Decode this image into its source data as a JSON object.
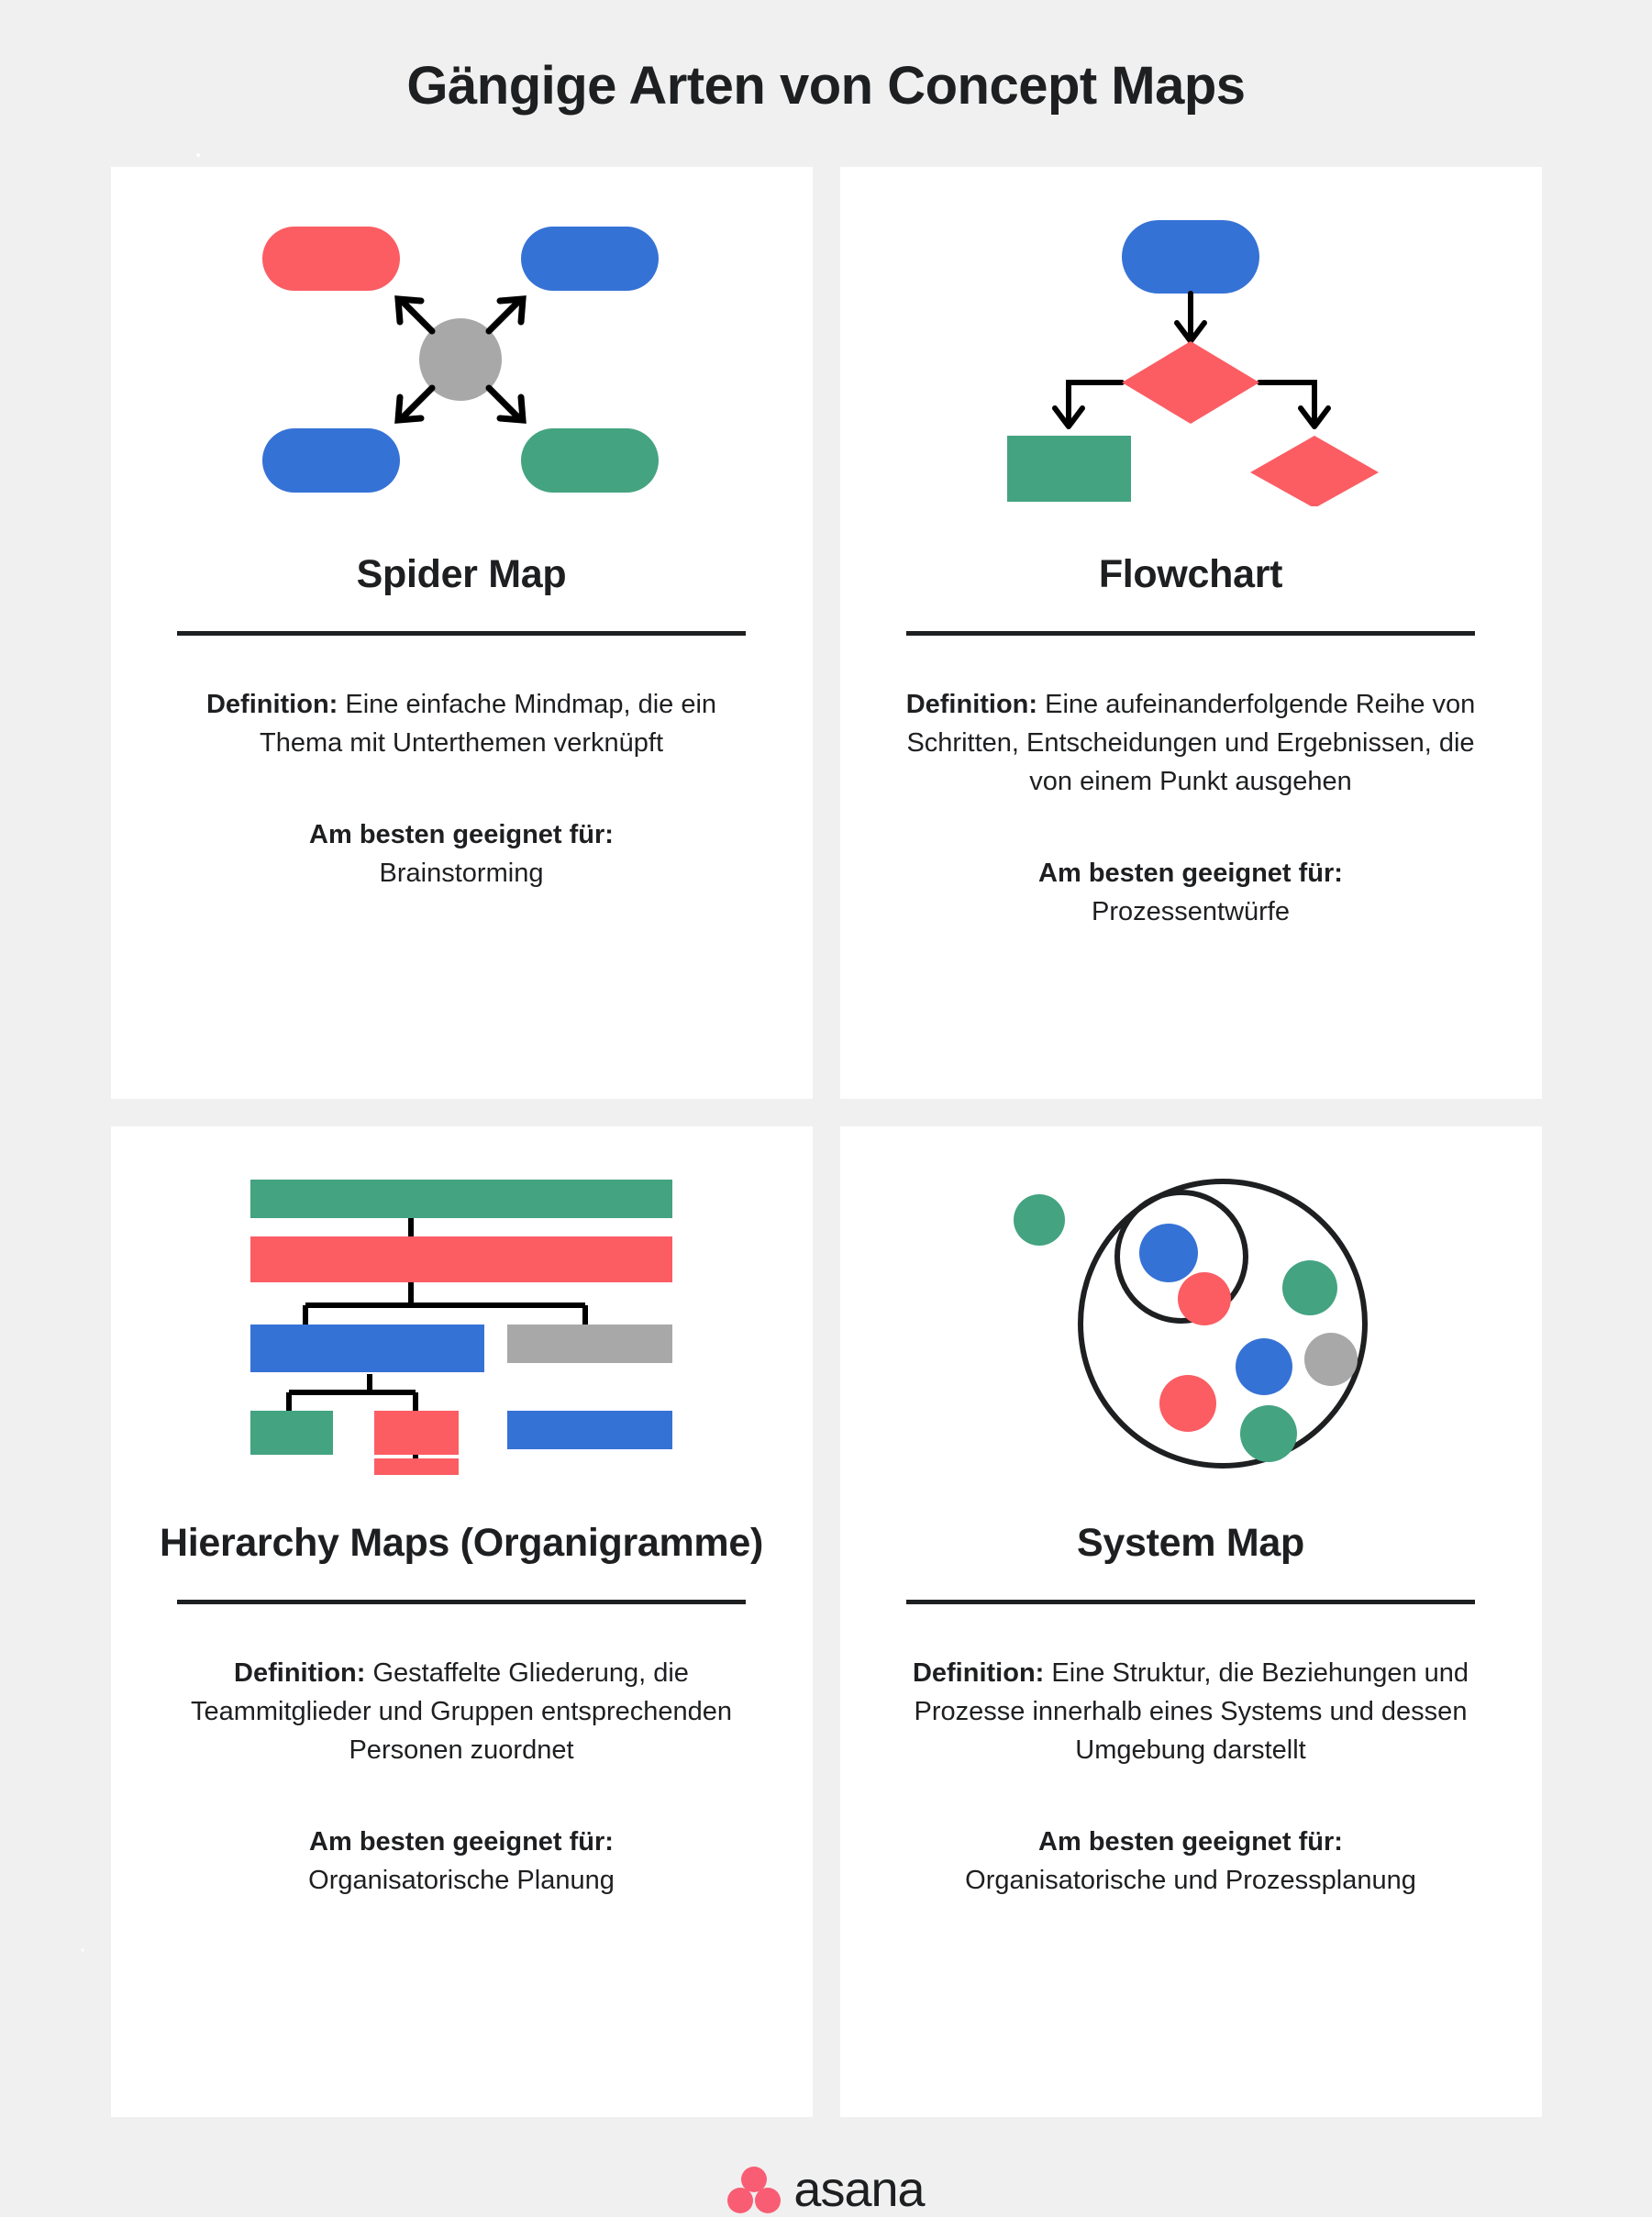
{
  "page": {
    "title": "Gängige Arten von Concept Maps",
    "background_color": "#F0F0F0",
    "card_background": "#FFFFFF",
    "text_color": "#1E1F21"
  },
  "palette": {
    "red": "#FB5D63",
    "blue": "#3572D6",
    "green": "#44A381",
    "gray": "#A8A8A8",
    "black": "#1E1F21",
    "asana_coral": "#F95D74"
  },
  "labels": {
    "definition_label": "Definition:",
    "best_for_label": "Am besten geeignet für:"
  },
  "cards": [
    {
      "id": "spider-map",
      "title": "Spider Map",
      "definition_label": "Definition:",
      "definition_text": "Eine einfache Mindmap, die ein Thema mit Unterthemen verknüpft",
      "best_for_label": "Am besten geeignet für:",
      "best_for_value": "Brainstorming",
      "diagram": {
        "type": "spider",
        "center_node": {
          "shape": "circle",
          "color": "#A8A8A8"
        },
        "nodes": [
          {
            "position": "top-left",
            "shape": "pill",
            "color": "#FB5D63"
          },
          {
            "position": "top-right",
            "shape": "pill",
            "color": "#3572D6"
          },
          {
            "position": "bottom-left",
            "shape": "pill",
            "color": "#3572D6"
          },
          {
            "position": "bottom-right",
            "shape": "pill",
            "color": "#44A381"
          }
        ],
        "connector_count": 4,
        "connector_style": "diagonal-arrow"
      }
    },
    {
      "id": "flowchart",
      "title": "Flowchart",
      "definition_label": "Definition:",
      "definition_text": "Eine aufeinanderfolgende Reihe von Schritten, Entscheidungen und Ergebnissen, die von einem Punkt ausgehen",
      "best_for_label": "Am besten geeignet für:",
      "best_for_value": "Prozessentwürfe",
      "diagram": {
        "type": "flowchart",
        "nodes": [
          {
            "id": "start",
            "shape": "pill",
            "color": "#3572D6"
          },
          {
            "id": "decision-1",
            "shape": "diamond",
            "color": "#FB5D63"
          },
          {
            "id": "result",
            "shape": "rect",
            "color": "#44A381"
          },
          {
            "id": "decision-2",
            "shape": "diamond",
            "color": "#FB5D63"
          }
        ],
        "connector_count": 3,
        "connector_style": "orthogonal-arrow"
      }
    },
    {
      "id": "hierarchy-map",
      "title": "Hierarchy Maps (Organigramme)",
      "title_lines": [
        "Hierarchy Maps",
        "(Organigramme)"
      ],
      "definition_label": "Definition:",
      "definition_text": "Gestaffelte Gliederung, die Teammitglieder und Gruppen entsprechenden Personen zuordnet",
      "best_for_label": "Am besten geeignet für:",
      "best_for_value": "Organisatorische Planung",
      "diagram": {
        "type": "hierarchy",
        "levels": [
          [
            {
              "color": "#44A381",
              "width": "full"
            }
          ],
          [
            {
              "color": "#FB5D63",
              "width": "full"
            }
          ],
          [
            {
              "color": "#3572D6",
              "width": "half"
            },
            {
              "color": "#A8A8A8",
              "width": "half"
            }
          ],
          [
            {
              "color": "#44A381",
              "width": "quarter"
            },
            {
              "color": "#FB5D63",
              "width": "quarter"
            },
            {
              "color": "#3572D6",
              "width": "half"
            }
          ],
          [
            {
              "color": "#FB5D63",
              "width": "quarter"
            }
          ]
        ],
        "connector_style": "orthogonal-line"
      }
    },
    {
      "id": "system-map",
      "title": "System Map",
      "definition_label": "Definition:",
      "definition_text": "Eine Struktur, die Beziehungen und Prozesse innerhalb eines Systems und dessen Umgebung darstellt",
      "best_for_label": "Am besten geeignet für:",
      "best_for_value": "Organisatorische und Prozessplanung",
      "diagram": {
        "type": "system",
        "outer_circle": {
          "stroke": "#1E1F21"
        },
        "inner_circle": {
          "stroke": "#1E1F21"
        },
        "dots": [
          {
            "color": "#44A381",
            "region": "outside"
          },
          {
            "color": "#3572D6",
            "region": "inner"
          },
          {
            "color": "#FB5D63",
            "region": "inner"
          },
          {
            "color": "#44A381",
            "region": "outer"
          },
          {
            "color": "#3572D6",
            "region": "outer"
          },
          {
            "color": "#A8A8A8",
            "region": "outer"
          },
          {
            "color": "#FB5D63",
            "region": "outer"
          },
          {
            "color": "#44A381",
            "region": "outer"
          }
        ]
      }
    }
  ],
  "footer": {
    "brand": "asana",
    "logo_icon": "asana-dots-icon"
  }
}
